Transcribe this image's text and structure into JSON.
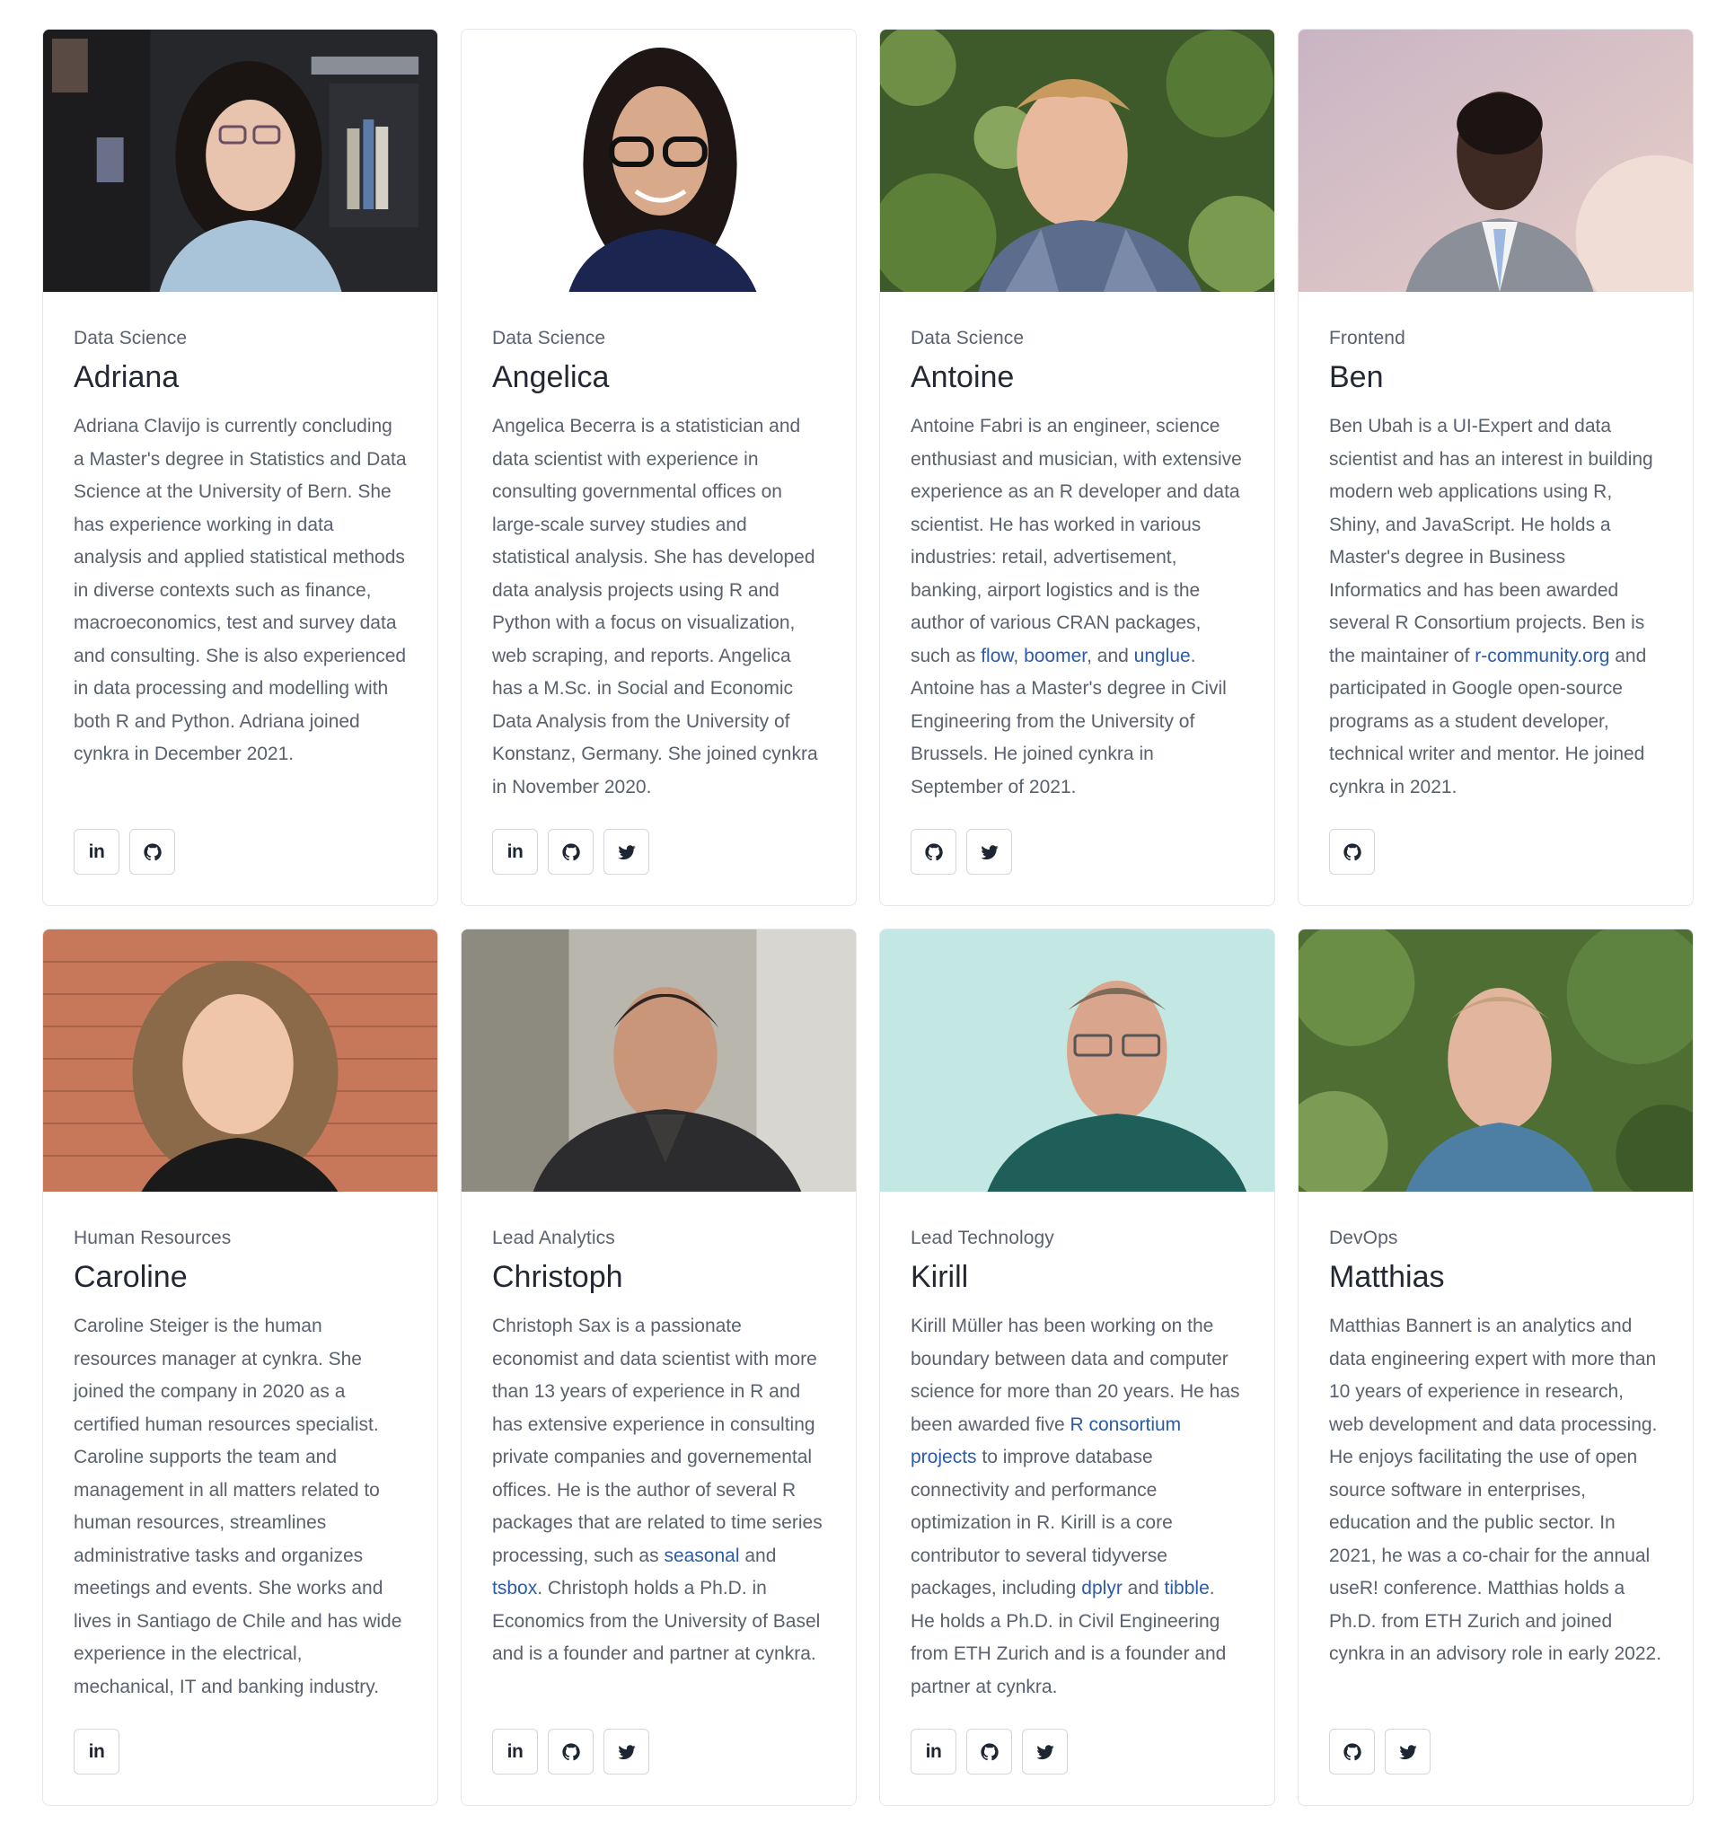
{
  "team": [
    {
      "department": "Data Science",
      "name": "Adriana",
      "photo_alt": "Adriana",
      "bio": [
        {
          "text": "Adriana Clavijo is currently concluding a Master's degree in Statistics and Data Science at the University of Bern. She has experience working in data analysis and applied statistical methods in diverse contexts such as finance, macroeconomics, test and survey data and consulting. She is also experienced in data processing and modelling with both R and Python. Adriana joined cynkra in December 2021."
        }
      ],
      "socials": [
        "linkedin-icon",
        "github-icon"
      ]
    },
    {
      "department": "Data Science",
      "name": "Angelica",
      "photo_alt": "Angelica",
      "bio": [
        {
          "text": "Angelica Becerra is a statistician and data scientist with experience in consulting governmental offices on large-scale survey studies and statistical analysis. She has developed data analysis projects using R and Python with a focus on visualization, web scraping, and reports. Angelica has a M.Sc. in Social and Economic Data Analysis from the University of Konstanz, Germany. She joined cynkra in November 2020."
        }
      ],
      "socials": [
        "linkedin-icon",
        "github-icon",
        "twitter-icon"
      ]
    },
    {
      "department": "Data Science",
      "name": "Antoine",
      "photo_alt": "Antoine",
      "bio": [
        {
          "text": "Antoine Fabri is an engineer, science enthusiast and musician, with extensive experience as an R developer and data scientist. He has worked in various industries: retail, advertisement, banking, airport logistics and is the author of various CRAN packages, such as "
        },
        {
          "text": "flow",
          "link": true
        },
        {
          "text": ", "
        },
        {
          "text": "boomer",
          "link": true
        },
        {
          "text": ", and "
        },
        {
          "text": "unglue",
          "link": true
        },
        {
          "text": ". Antoine has a Master's degree in Civil Engineering from the University of Brussels. He joined cynkra in September of 2021."
        }
      ],
      "socials": [
        "github-icon",
        "twitter-icon"
      ]
    },
    {
      "department": "Frontend",
      "name": "Ben",
      "photo_alt": "Ben",
      "bio": [
        {
          "text": "Ben Ubah is a UI-Expert and data scientist and has an interest in building modern web applications using R, Shiny, and JavaScript. He holds a Master's degree in Business Informatics and has been awarded several R Consortium projects. Ben is the maintainer of "
        },
        {
          "text": "r-community.org",
          "link": true
        },
        {
          "text": " and participated in Google open-source programs as a student developer, technical writer and mentor. He joined cynkra in 2021."
        }
      ],
      "socials": [
        "github-icon"
      ]
    },
    {
      "department": "Human Resources",
      "name": "Caroline",
      "photo_alt": "Caroline",
      "bio": [
        {
          "text": "Caroline Steiger is the human resources manager at cynkra. She joined the company in 2020 as a certified human resources specialist. Caroline supports the team and management in all matters related to human resources, streamlines administrative tasks and organizes meetings and events. She works and lives in Santiago de Chile and has wide experience in the electrical, mechanical, IT and banking industry."
        }
      ],
      "socials": [
        "linkedin-icon"
      ]
    },
    {
      "department": "Lead Analytics",
      "name": "Christoph",
      "photo_alt": "Christoph",
      "bio": [
        {
          "text": "Christoph Sax is a passionate economist and data scientist with more than 13 years of experience in R and has extensive experience in consulting private companies and governemental offices. He is the author of several R packages that are related to time series processing, such as "
        },
        {
          "text": "seasonal",
          "link": true
        },
        {
          "text": " and "
        },
        {
          "text": "tsbox",
          "link": true
        },
        {
          "text": ". Christoph holds a Ph.D. in Economics from the University of Basel and is a founder and partner at cynkra."
        }
      ],
      "socials": [
        "linkedin-icon",
        "github-icon",
        "twitter-icon"
      ]
    },
    {
      "department": "Lead Technology",
      "name": "Kirill",
      "photo_alt": "Kirill",
      "bio": [
        {
          "text": "Kirill Müller has been working on the boundary between data and computer science for more than 20 years. He has been awarded five "
        },
        {
          "text": "R consortium projects",
          "link": true
        },
        {
          "text": " to improve database connectivity and performance optimization in R. Kirill is a core contributor to several tidyverse packages, including "
        },
        {
          "text": "dplyr",
          "link": true
        },
        {
          "text": " and "
        },
        {
          "text": "tibble",
          "link": true
        },
        {
          "text": ". He holds a Ph.D. in Civil Engineering from ETH Zurich and is a founder and partner at cynkra."
        }
      ],
      "socials": [
        "linkedin-icon",
        "github-icon",
        "twitter-icon"
      ]
    },
    {
      "department": "DevOps",
      "name": "Matthias",
      "photo_alt": "Matthias",
      "bio": [
        {
          "text": "Matthias Bannert is an analytics and data engineering expert with more than 10 years of experience in research, web development and data processing. He enjoys facilitating the use of open source software in enterprises, education and the public sector. In 2021, he was a co-chair for the annual useR! conference. Matthias holds a Ph.D. from ETH Zurich and joined cynkra in an advisory role in early 2022."
        }
      ],
      "socials": [
        "github-icon",
        "twitter-icon"
      ]
    }
  ],
  "colors": {
    "link": "#2d5aa5",
    "text": "#5a616e",
    "heading": "#232833",
    "border": "#e3e6ea"
  }
}
